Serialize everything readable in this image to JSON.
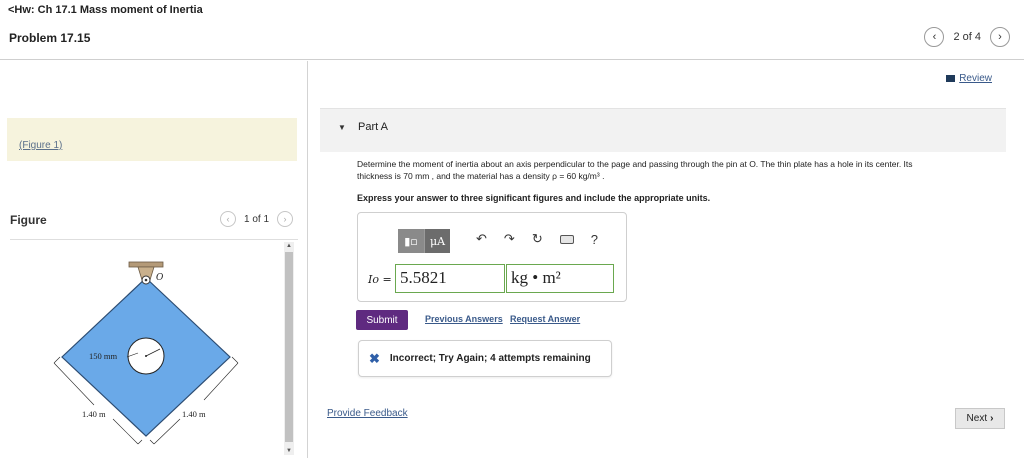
{
  "header": {
    "back_label": "<Hw: Ch 17.1 Mass moment of Inertia",
    "problem_title": "Problem 17.15",
    "pager_text": "2 of 4"
  },
  "left": {
    "figure_link": "(Figure 1)",
    "figure_heading": "Figure",
    "figure_pager": "1 of 1",
    "figure": {
      "pin_label": "O",
      "hole_label": "150 mm",
      "side_left": "1.40 m",
      "side_right": "1.40 m"
    }
  },
  "main": {
    "review_label": "Review",
    "part_label": "Part A",
    "question_line1": "Determine the moment of inertia about an axis perpendicular to the page and passing through the pin at O. The thin plate has a hole in its center. Its",
    "question_line2": "thickness is 70 mm , and the material has a density ρ = 60 kg/m³ .",
    "instructions": "Express your answer to three significant figures and include the appropriate units.",
    "answer": {
      "symbol": "Io =",
      "value": "5.5821",
      "units": "kg • m²",
      "mu_label": "μA"
    },
    "submit_label": "Submit",
    "previous_answers_label": "Previous Answers",
    "request_answer_label": "Request Answer",
    "feedback_message": "Incorrect; Try Again; 4 attempts remaining",
    "provide_feedback_label": "Provide Feedback",
    "next_label": "Next"
  },
  "colors": {
    "accent": "#5f2a80",
    "link": "#3a5a8a",
    "plate": "#6aa9e8",
    "figure_band": "#f6f3dd",
    "answer_border": "#6aa84f"
  }
}
